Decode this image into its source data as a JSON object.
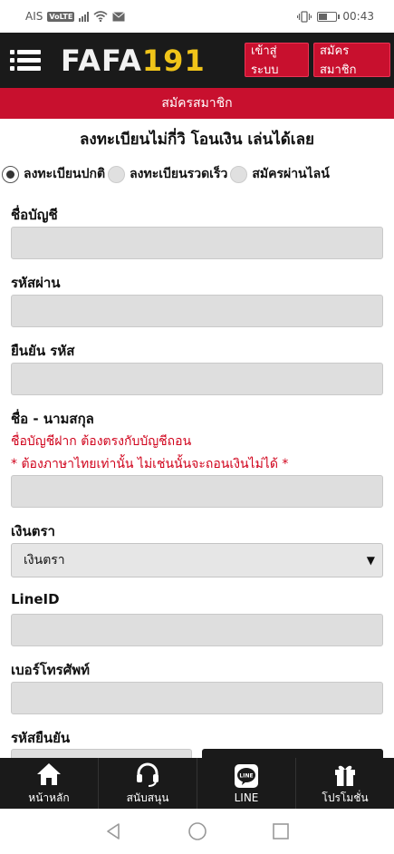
{
  "status_bar": {
    "carrier": "AIS",
    "volte": "VoLTE",
    "time": "00:43",
    "battery_level": 0.5
  },
  "header": {
    "logo_part1": "FAFA",
    "logo_part2": "191",
    "login_label": "เข้าสู่ระบบ",
    "register_label": "สมัครสมาชิก"
  },
  "title_bar": "สมัครสมาชิก",
  "headline": "ลงทะเบียนไม่กี่วิ โอนเงิน เล่นได้เลย",
  "radios": [
    {
      "label": "ลงทะเบียนปกติ",
      "checked": true
    },
    {
      "label": "ลงทะเบียนรวดเร็ว",
      "checked": false
    },
    {
      "label": "สมัครผ่านไลน์",
      "checked": false
    }
  ],
  "form": {
    "username_label": "ชื่อบัญชี",
    "password_label": "รหัสผ่าน",
    "confirm_password_label": "ยืนยัน รหัส",
    "fullname_label": "ชื่อ - นามสกุล",
    "fullname_note1": "ชื่อบัญชีฝาก ต้องตรงกับบัญชีถอน",
    "fullname_note2": "* ต้องภาษาไทยเท่านั้น ไม่เช่นนั้นจะถอนเงินไม่ได้ *",
    "currency_label": "เงินตรา",
    "currency_selected": "เงินตรา",
    "lineid_label": "LineID",
    "phone_label": "เบอร์โทรศัพท์",
    "otp_label": "รหัสยืนยัน"
  },
  "bottom_nav": {
    "home": "หน้าหลัก",
    "support": "สนับสนุน",
    "line": "LINE",
    "promotion": "โปรโมชั่น",
    "line_icon_text": "LINE"
  },
  "colors": {
    "brand_red": "#c8102e",
    "header_black": "#1a1a1a",
    "logo_gold": "#f0c419",
    "note_red": "#d0021b"
  }
}
